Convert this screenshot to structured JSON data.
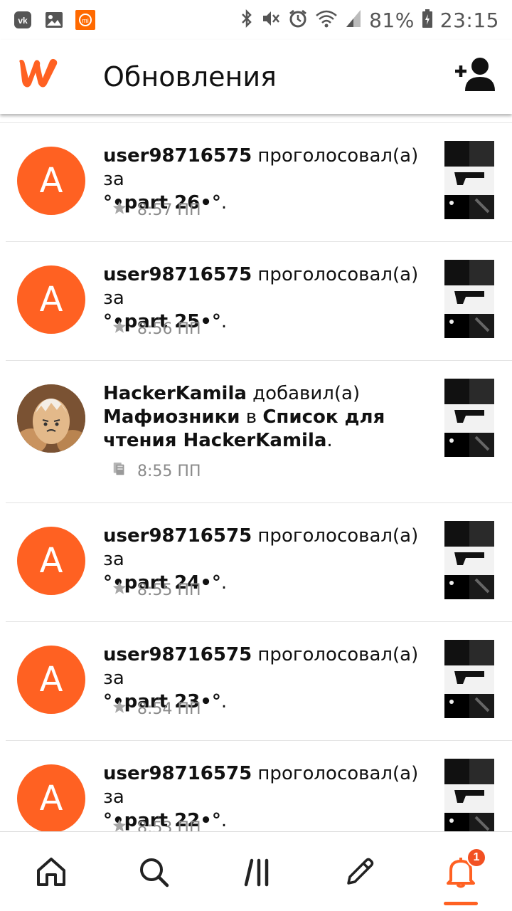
{
  "status_bar": {
    "battery_percent": "81%",
    "time": "23:15",
    "icons": [
      "vk-icon",
      "gallery-icon",
      "mi-icon",
      "bluetooth-icon",
      "mute-icon",
      "alarm-icon",
      "wifi-icon",
      "signal-icon",
      "battery-icon"
    ]
  },
  "app_bar": {
    "title": "Обновления",
    "logo": "wattpad-logo",
    "action_icon": "add-user-icon"
  },
  "feed": [
    {
      "user": "user98716575",
      "action": " проголосовал(а) за",
      "object": "°•part 26•°",
      "tail": ".",
      "time": "8:57 ПП",
      "icon": "star-icon",
      "avatar_letter": "A",
      "avatar_type": "letter"
    },
    {
      "user": "user98716575",
      "action": " проголосовал(а) за",
      "object": "°•part 25•°",
      "tail": ".",
      "time": "8:56 ПП",
      "icon": "star-icon",
      "avatar_letter": "A",
      "avatar_type": "letter"
    },
    {
      "user": "HackerKamila",
      "action": " добавил(а)",
      "object": "Мафиозники",
      "mid": " в ",
      "list": "Список для чтения HackerKamila",
      "tail": ".",
      "time": "8:55 ПП",
      "icon": "reading-list-icon",
      "avatar_type": "photo"
    },
    {
      "user": "user98716575",
      "action": " проголосовал(а) за",
      "object": "°•part 24•°",
      "tail": ".",
      "time": "8:55 ПП",
      "icon": "star-icon",
      "avatar_letter": "A",
      "avatar_type": "letter"
    },
    {
      "user": "user98716575",
      "action": " проголосовал(а) за",
      "object": "°•part 23•°",
      "tail": ".",
      "time": "8:54 ПП",
      "icon": "star-icon",
      "avatar_letter": "A",
      "avatar_type": "letter"
    },
    {
      "user": "user98716575",
      "action": " проголосовал(а) за",
      "object": "°•part 22•°",
      "tail": ".",
      "time": "8:53 ПП",
      "icon": "star-icon",
      "avatar_letter": "A",
      "avatar_type": "letter"
    }
  ],
  "bottom_nav": {
    "items": [
      "home-icon",
      "search-icon",
      "library-icon",
      "write-icon",
      "notifications-icon"
    ],
    "active": "notifications-icon",
    "notification_badge": "1"
  },
  "colors": {
    "accent": "#ff6122",
    "badge": "#f25022",
    "meta_text": "#8a8a8a"
  }
}
